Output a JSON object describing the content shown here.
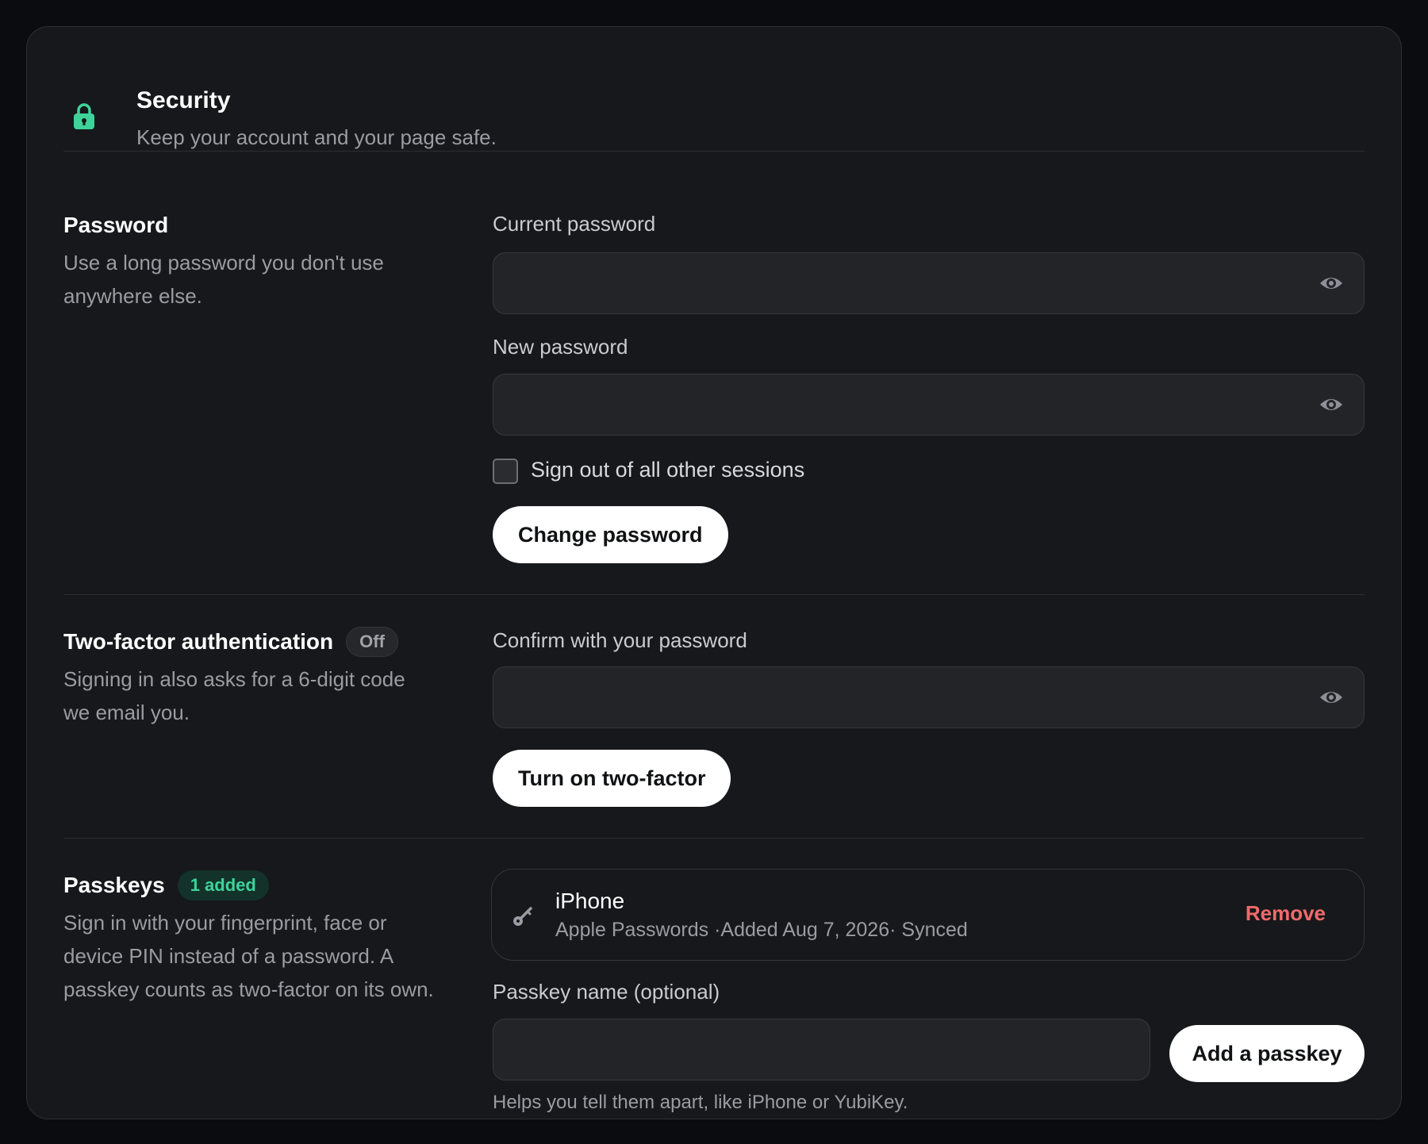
{
  "header": {
    "title": "Security",
    "subtitle": "Keep your account and your page safe."
  },
  "password": {
    "title": "Password",
    "description": "Use a long password you don't use anywhere else.",
    "current_label": "Current password",
    "current_value": "",
    "new_label": "New password",
    "new_value": "",
    "signout_label": "Sign out of all other sessions",
    "signout_checked": false,
    "button": "Change password"
  },
  "twofactor": {
    "title": "Two-factor authentication",
    "badge": "Off",
    "description": "Signing in also asks for a 6-digit code we email you.",
    "confirm_label": "Confirm with your password",
    "confirm_value": "",
    "button": "Turn on two-factor"
  },
  "passkeys": {
    "title": "Passkeys",
    "badge": "1 added",
    "description": "Sign in with your fingerprint, face or device PIN instead of a password. A passkey counts as two-factor on its own.",
    "items": [
      {
        "name": "iPhone",
        "meta": "Apple Passwords ·Added Aug 7, 2026· Synced",
        "remove": "Remove"
      }
    ],
    "name_label": "Passkey name (optional)",
    "name_value": "",
    "add_button": "Add a passkey",
    "hint": "Helps you tell them apart, like iPhone or YubiKey."
  },
  "colors": {
    "accent_green": "#3ed39a",
    "danger": "#f06b6b",
    "background": "#17181b"
  },
  "icons": [
    "lock-icon",
    "eye-icon",
    "key-icon"
  ]
}
